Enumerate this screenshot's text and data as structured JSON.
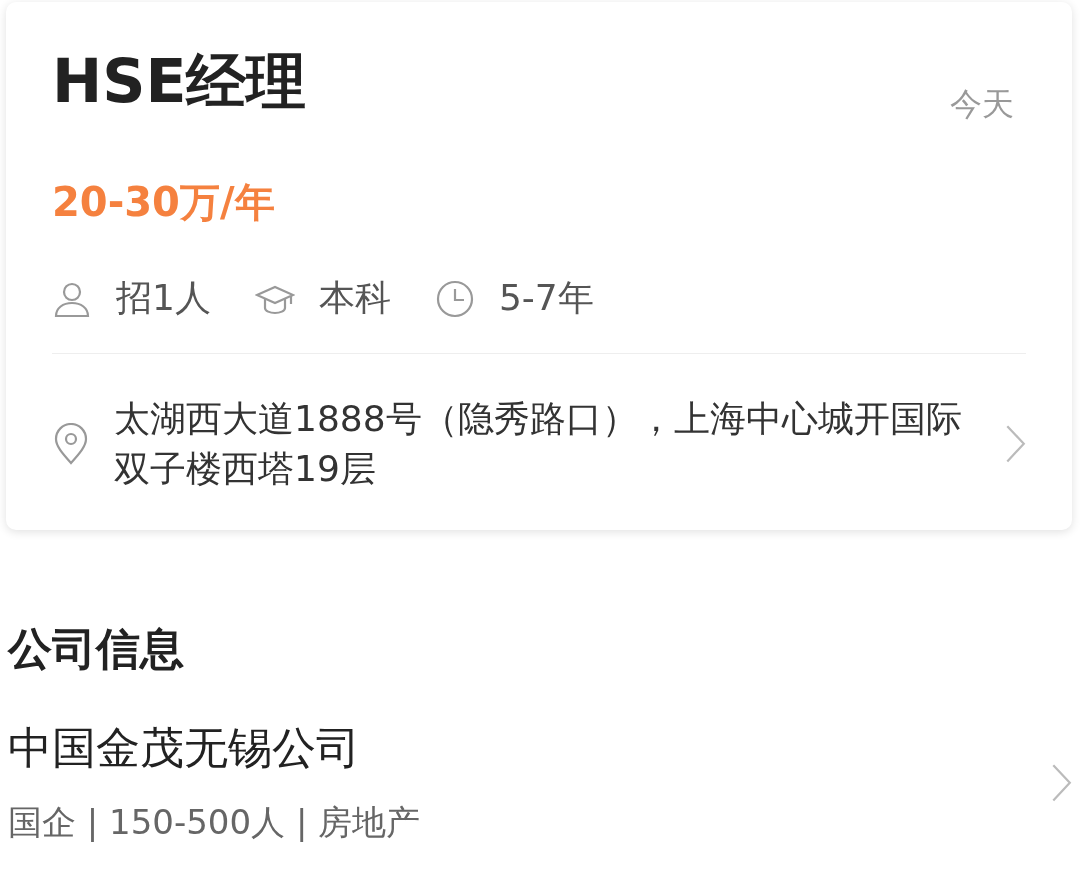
{
  "job": {
    "title": "HSE经理",
    "posted": "今天",
    "salary": "20-30万/年",
    "requirements": [
      {
        "kind": "people",
        "text": "招1人"
      },
      {
        "kind": "education",
        "text": "本科"
      },
      {
        "kind": "experience",
        "text": "5-7年"
      }
    ],
    "address": "太湖西大道1888号（隐秀路口），上海中心城开国际双子楼西塔19层"
  },
  "company_section": {
    "heading": "公司信息",
    "name": "中国金茂无锡公司",
    "details": "国企 | 150-500人 | 房地产"
  }
}
